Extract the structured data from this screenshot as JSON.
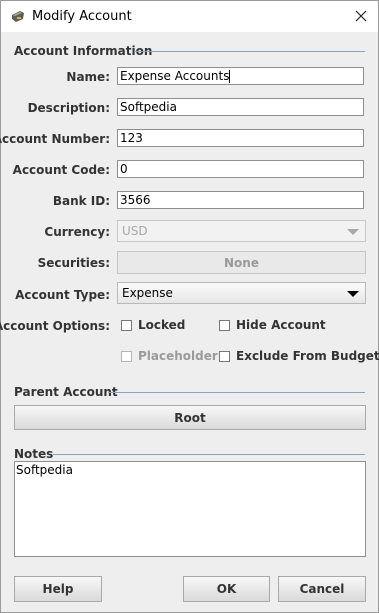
{
  "window": {
    "title": "Modify Account"
  },
  "sections": {
    "account_info": "Account Information",
    "parent_account": "Parent Account",
    "notes": "Notes"
  },
  "fields": {
    "name": {
      "label": "Name:",
      "value": "Expense Accounts"
    },
    "description": {
      "label": "Description:",
      "value": "Softpedia"
    },
    "account_number": {
      "label": "Account Number:",
      "value": "123"
    },
    "account_code": {
      "label": "Account Code:",
      "value": "0"
    },
    "bank_id": {
      "label": "Bank ID:",
      "value": "3566"
    },
    "currency": {
      "label": "Currency:",
      "value": "USD",
      "enabled": false
    },
    "securities": {
      "label": "Securities:",
      "value": "None",
      "enabled": false
    },
    "account_type": {
      "label": "Account Type:",
      "value": "Expense"
    }
  },
  "options": {
    "label": "Account Options:",
    "locked": {
      "label": "Locked",
      "checked": false
    },
    "hide_account": {
      "label": "Hide Account",
      "checked": false
    },
    "placeholder": {
      "label": "Placeholder",
      "checked": false,
      "enabled": false
    },
    "exclude_budgets": {
      "label": "Exclude From Budgets",
      "checked": false
    }
  },
  "parent_account": {
    "value": "Root"
  },
  "notes": {
    "value": "Softpedia"
  },
  "buttons": {
    "help": "Help",
    "ok": "OK",
    "cancel": "Cancel"
  },
  "colors": {
    "section_line": "#8ca0c4",
    "dialog_bg": "#eeeeee",
    "disabled_text": "#9a9a9a"
  },
  "icons": {
    "app": "wallet-icon",
    "close": "close-icon",
    "dropdown": "chevron-down-icon"
  }
}
